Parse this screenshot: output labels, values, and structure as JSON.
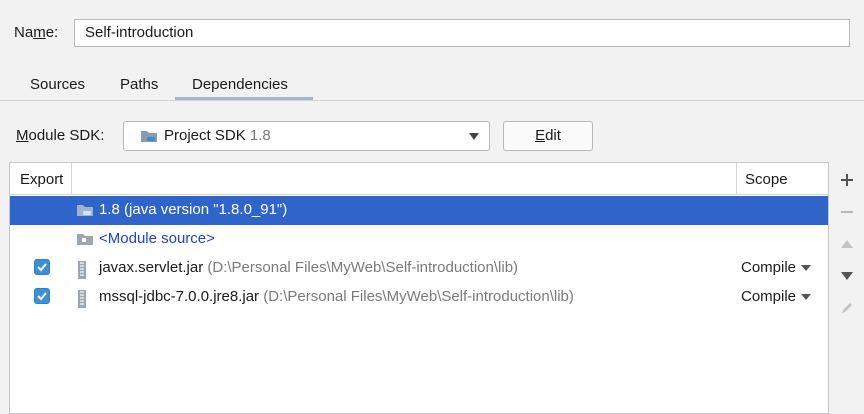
{
  "name_field": {
    "label_prefix": "Na",
    "label_mnemonic": "m",
    "label_suffix": "e:",
    "value": "Self-introduction"
  },
  "tabs": [
    {
      "label": "Sources",
      "active": false
    },
    {
      "label": "Paths",
      "active": false
    },
    {
      "label": "Dependencies",
      "active": true
    }
  ],
  "module_sdk": {
    "label_mnemonic": "M",
    "label_rest": "odule SDK:",
    "selected": "Project SDK",
    "version": "1.8",
    "edit_mnemonic": "E",
    "edit_rest": "dit"
  },
  "table": {
    "headers": {
      "export": "Export",
      "scope": "Scope"
    },
    "rows": [
      {
        "type": "sdk",
        "name": "1.8 (java version \"1.8.0_91\")",
        "selected": true
      },
      {
        "type": "module-source",
        "name": "<Module source>"
      },
      {
        "type": "jar",
        "name": "javax.servlet.jar",
        "path": "(D:\\Personal Files\\MyWeb\\Self-introduction\\lib)",
        "checked": true,
        "scope": "Compile"
      },
      {
        "type": "jar",
        "name": "mssql-jdbc-7.0.0.jre8.jar",
        "path": "(D:\\Personal Files\\MyWeb\\Self-introduction\\lib)",
        "checked": true,
        "scope": "Compile"
      }
    ]
  },
  "toolbar": {
    "icons": [
      "add-icon",
      "remove-icon",
      "move-up-icon",
      "move-down-icon",
      "edit-pencil-icon"
    ]
  },
  "colors": {
    "selection": "#2f65ca",
    "checkbox": "#3d8fd6",
    "module_source": "#1a3fdc"
  }
}
